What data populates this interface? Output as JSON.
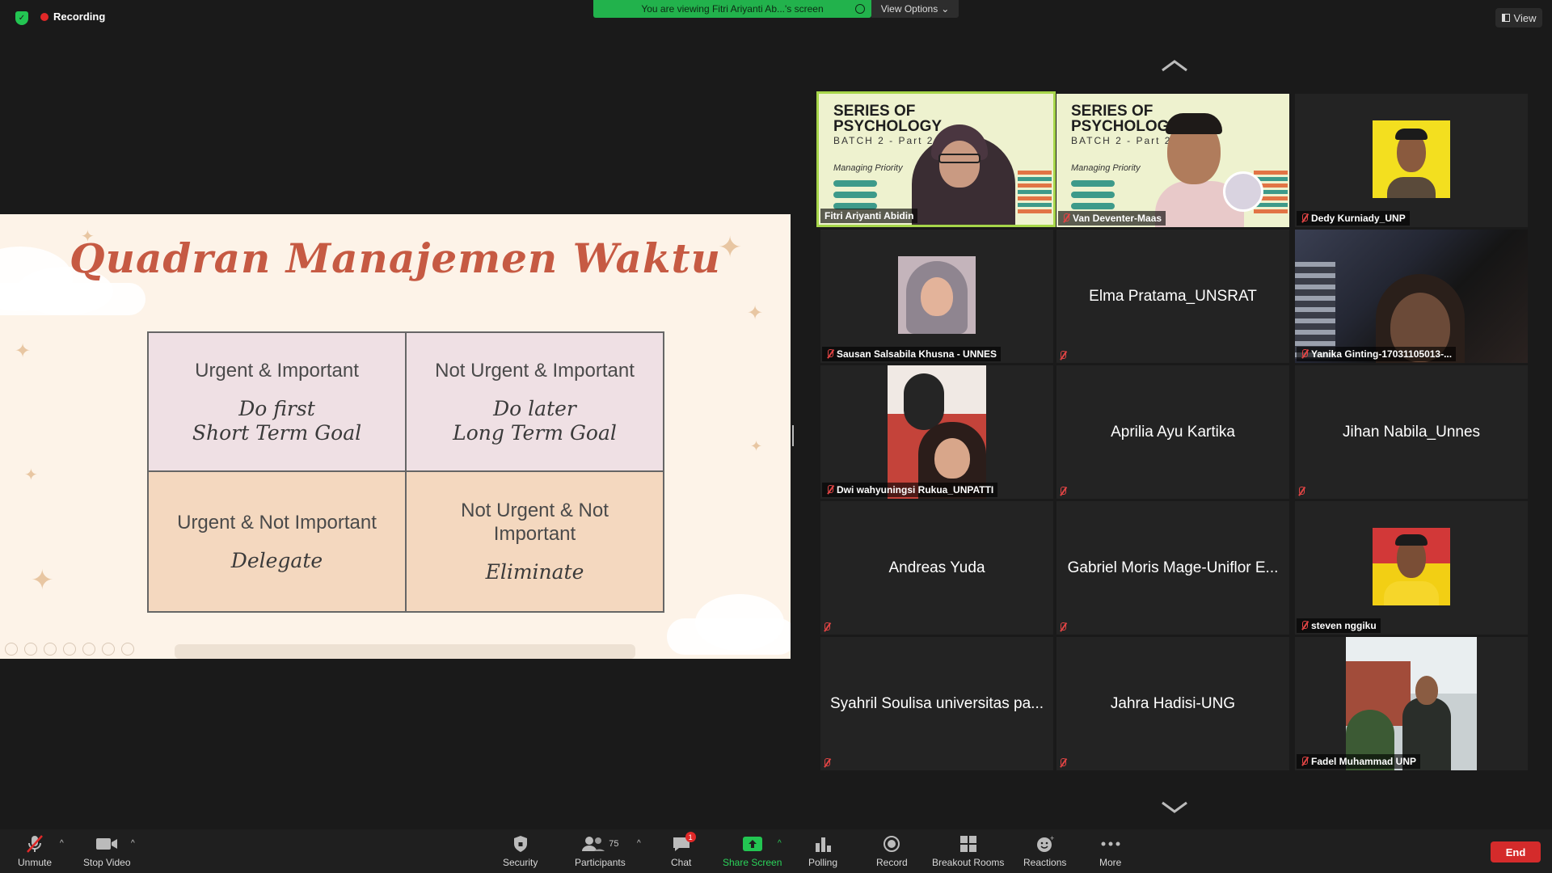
{
  "top": {
    "recording_label": "Recording",
    "viewing_banner": "You are viewing Fitri Ariyanti Ab...'s screen",
    "view_options_label": "View Options",
    "view_label": "View"
  },
  "slide": {
    "title": "Quadran Manajemen Waktu",
    "quadrants": [
      {
        "heading": "Urgent & Important",
        "line1": "Do first",
        "line2": "Short Term Goal"
      },
      {
        "heading": "Not Urgent & Important",
        "line1": "Do later",
        "line2": "Long Term Goal"
      },
      {
        "heading": "Urgent & Not Important",
        "line1": "Delegate",
        "line2": ""
      },
      {
        "heading": "Not Urgent & Not Important",
        "line1": "Eliminate",
        "line2": ""
      }
    ]
  },
  "promo": {
    "title_line1": "SERIES OF",
    "title_line2": "PSYCHOLOGY",
    "batch": "BATCH 2 - Part 2",
    "topic": "Managing Priority"
  },
  "participants": [
    {
      "name": "Fitri Ariyanti Abidin",
      "kind": "promo-video",
      "muted": false,
      "active": true
    },
    {
      "name": "Van Deventer-Maas",
      "kind": "promo-video",
      "muted": true,
      "active": false
    },
    {
      "name": "Dedy Kurniady_UNP",
      "kind": "photo",
      "muted": true,
      "active": false
    },
    {
      "name": "Sausan Salsabila Khusna - UNNES",
      "kind": "photo",
      "muted": true,
      "active": false
    },
    {
      "name": "Elma Pratama_UNSRAT",
      "kind": "name",
      "muted": true,
      "active": false
    },
    {
      "name": "Yanika Ginting-17031105013-...",
      "kind": "video",
      "muted": true,
      "active": false
    },
    {
      "name": "Dwi wahyuningsi Rukua_UNPATTI",
      "kind": "photo",
      "muted": true,
      "active": false
    },
    {
      "name": "Aprilia Ayu Kartika",
      "kind": "name",
      "muted": true,
      "active": false
    },
    {
      "name": "Jihan Nabila_Unnes",
      "kind": "name",
      "muted": true,
      "active": false
    },
    {
      "name": "Andreas Yuda",
      "kind": "name",
      "muted": true,
      "active": false
    },
    {
      "name": "Gabriel Moris Mage-Uniflor E...",
      "kind": "name",
      "muted": true,
      "active": false
    },
    {
      "name": "steven nggiku",
      "kind": "photo",
      "muted": true,
      "active": false
    },
    {
      "name": "Syahril Soulisa universitas pa...",
      "kind": "name",
      "muted": true,
      "active": false
    },
    {
      "name": "Jahra Hadisi-UNG",
      "kind": "name",
      "muted": true,
      "active": false
    },
    {
      "name": "Fadel Muhammad UNP",
      "kind": "photo",
      "muted": true,
      "active": false
    }
  ],
  "toolbar": {
    "unmute": "Unmute",
    "stop_video": "Stop Video",
    "security": "Security",
    "participants": "Participants",
    "participants_count": "75",
    "chat": "Chat",
    "chat_badge": "1",
    "share_screen": "Share Screen",
    "polling": "Polling",
    "record": "Record",
    "breakout_rooms": "Breakout Rooms",
    "reactions": "Reactions",
    "more": "More",
    "end": "End"
  },
  "colors": {
    "accent_green": "#22b24c",
    "active_speaker": "#a7d64a",
    "end_red": "#d42b2b",
    "slide_title": "#c65a43"
  }
}
